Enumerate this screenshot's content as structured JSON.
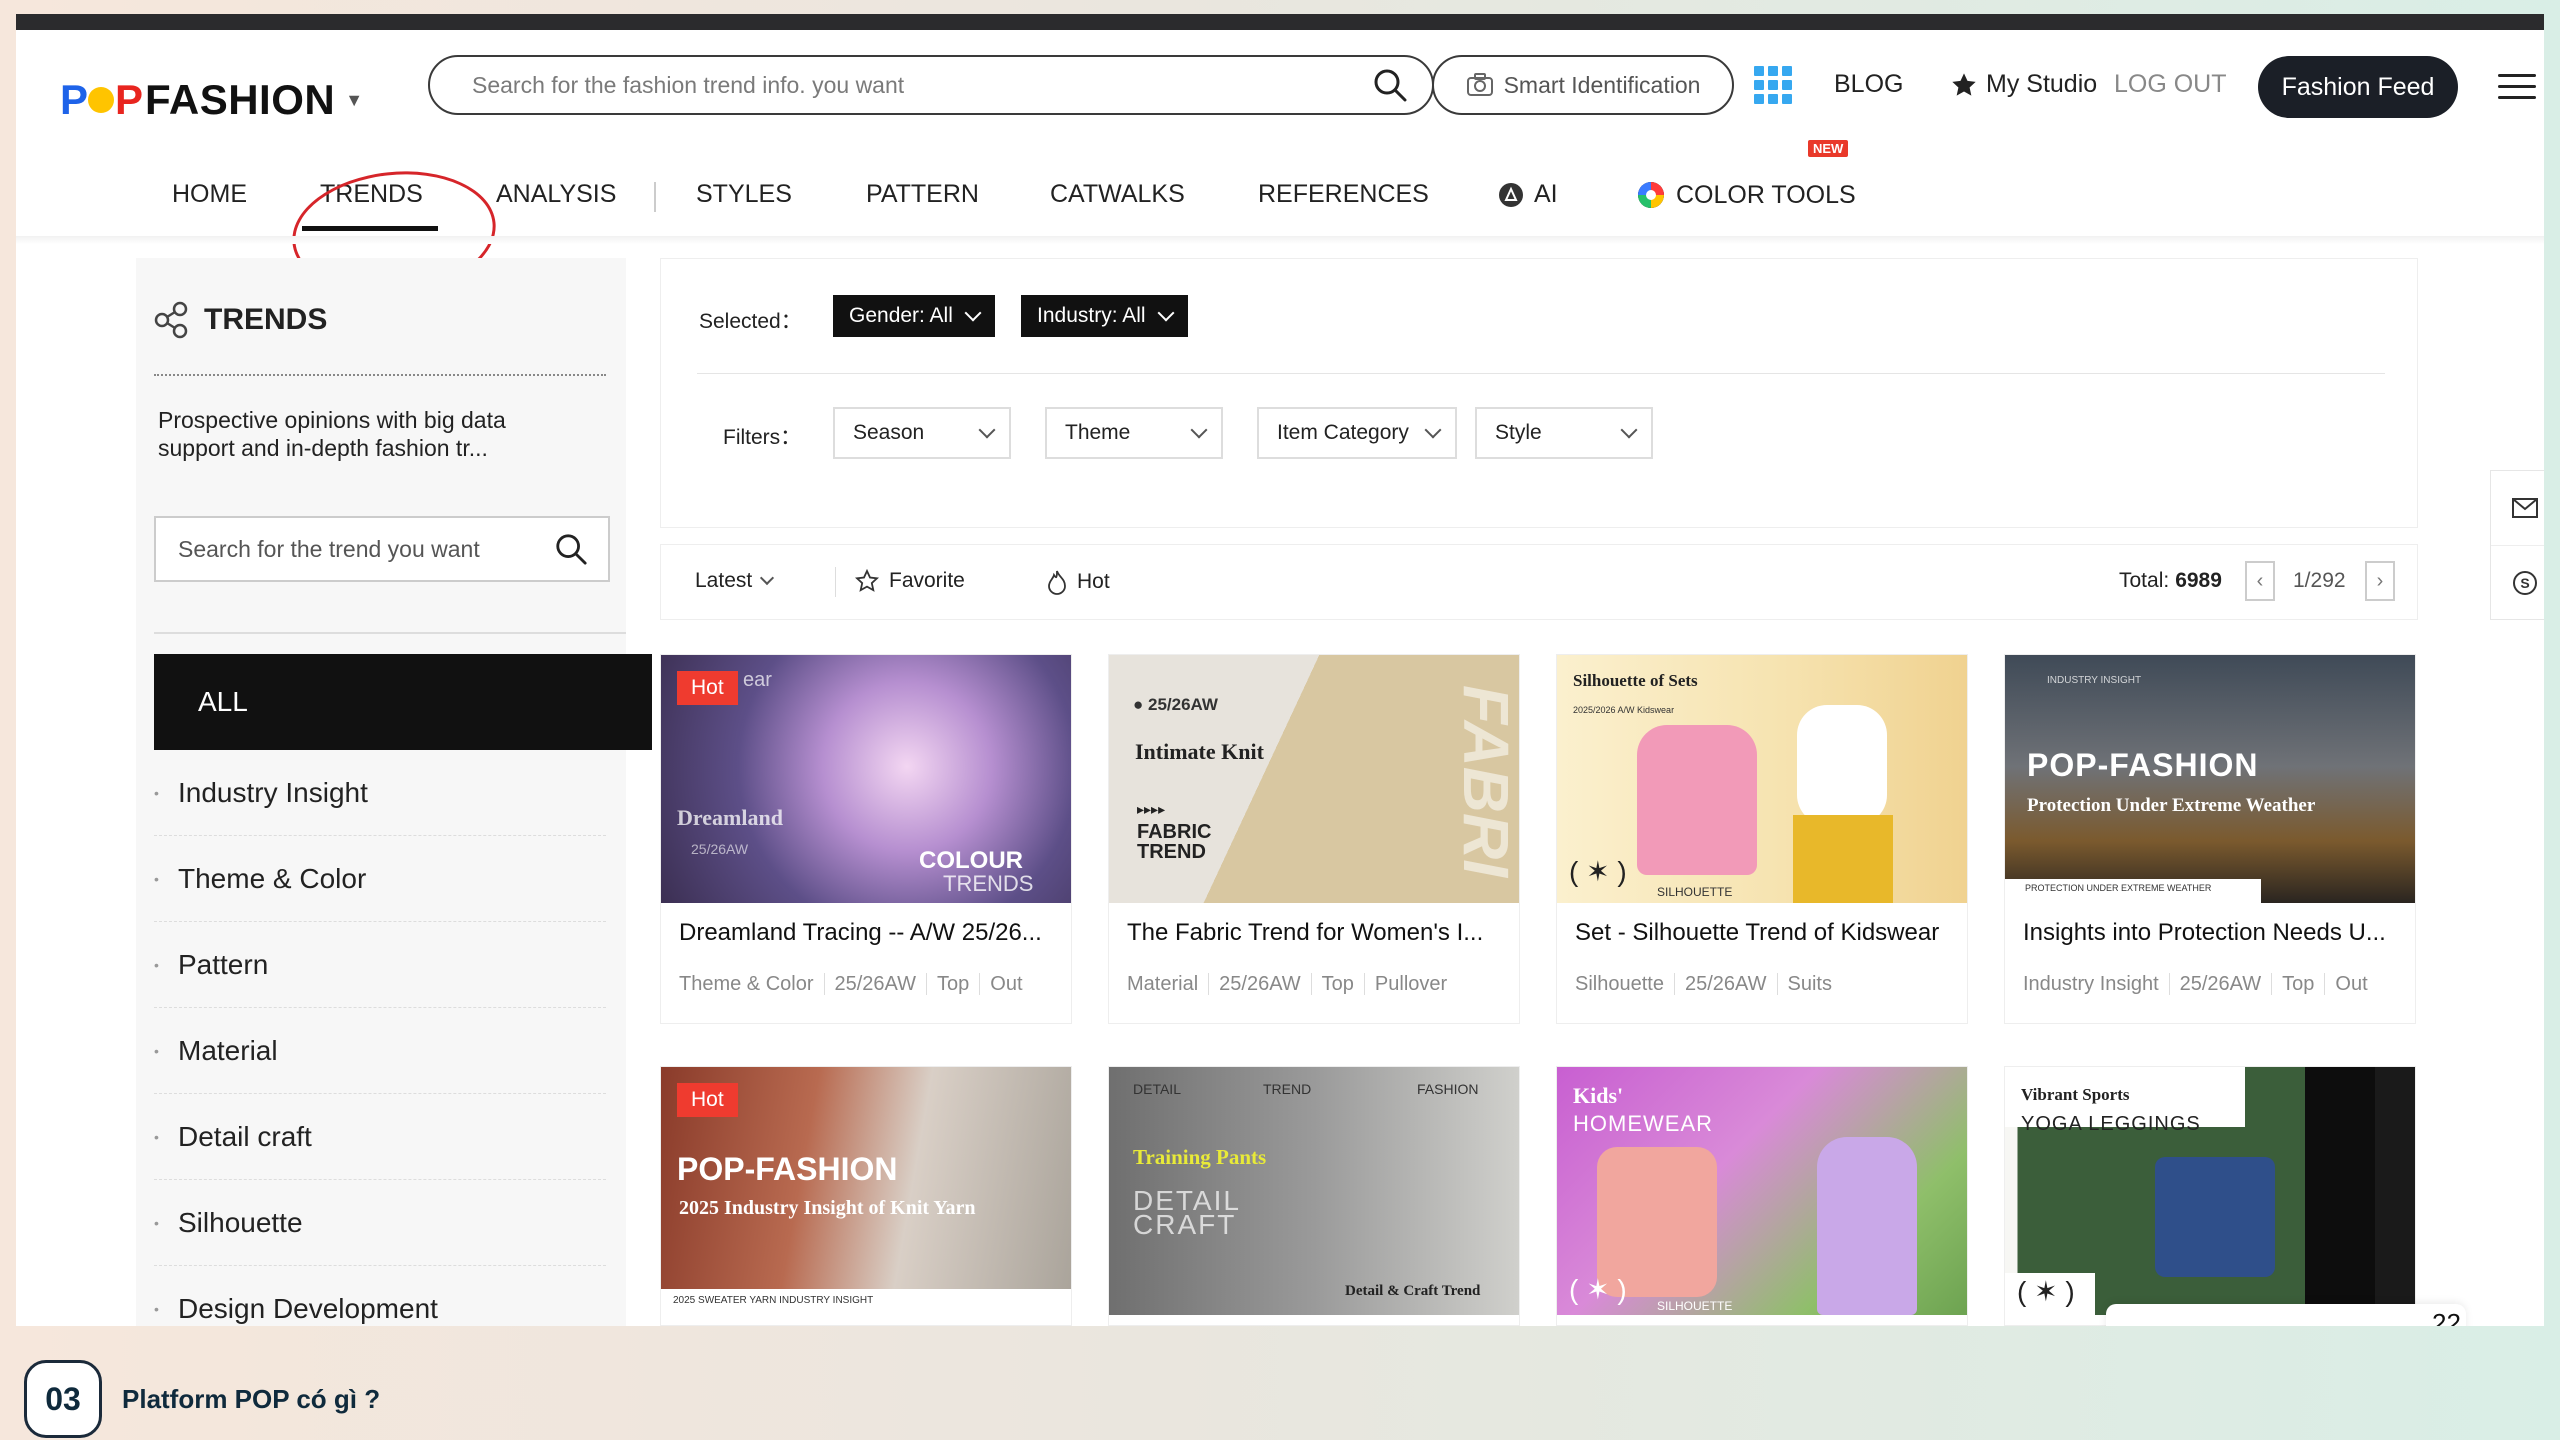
{
  "header": {
    "logo_text": "FASHION",
    "logo_prefix": "P",
    "logo_prefix2": "P",
    "search_placeholder": "Search for the fashion trend info. you want",
    "smart_identification": "Smart Identification",
    "blog": "BLOG",
    "my_studio": "My Studio",
    "log_out": "LOG OUT",
    "fashion_feed": "Fashion Feed"
  },
  "nav": {
    "items": [
      "HOME",
      "TRENDS",
      "ANALYSIS",
      "STYLES",
      "PATTERN",
      "CATWALKS",
      "REFERENCES",
      "AI",
      "COLOR TOOLS"
    ],
    "new_badge": "NEW",
    "active": "TRENDS"
  },
  "sidebar": {
    "title": "TRENDS",
    "description": "Prospective opinions with big data support and in-depth fashion tr...",
    "search_placeholder": "Search for the trend you want",
    "all_label": "ALL",
    "items": [
      "Industry Insight",
      "Theme & Color",
      "Pattern",
      "Material",
      "Detail craft",
      "Silhouette",
      "Design Development"
    ]
  },
  "filters": {
    "selected_label": "Selected：",
    "filters_label": "Filters：",
    "selected": [
      "Gender: All",
      "Industry: All"
    ],
    "dropdowns": [
      "Season",
      "Theme",
      "Item Category",
      "Style"
    ]
  },
  "sort": {
    "latest": "Latest",
    "favorite": "Favorite",
    "hot": "Hot",
    "total_label": "Total:",
    "total_value": "6989",
    "page": "1/292"
  },
  "cards": [
    {
      "title": "Dreamland Tracing -- A/W 25/26...",
      "tags": [
        "Theme & Color",
        "25/26AW",
        "Top",
        "Out"
      ],
      "hot": "Hot",
      "overlay": {
        "a": "Dreamland",
        "b": "25/26AW",
        "c": "COLOUR",
        "d": "TRENDS",
        "e": "ear"
      }
    },
    {
      "title": "The Fabric Trend for Women's I...",
      "tags": [
        "Material",
        "25/26AW",
        "Top",
        "Pullover"
      ],
      "overlay": {
        "a": "● 25/26AW",
        "b": "Intimate Knit",
        "c": "▸▸▸▸",
        "d": "FABRIC",
        "e": "TREND",
        "f": "FABRI"
      }
    },
    {
      "title": "Set - Silhouette Trend of Kidswear",
      "tags": [
        "Silhouette",
        "25/26AW",
        "Suits"
      ],
      "overlay": {
        "a": "Silhouette of Sets",
        "b": "2025/2026 A/W Kidswear",
        "c": "( ✶ )",
        "d": "SILHOUETTE"
      }
    },
    {
      "title": "Insights into Protection Needs U...",
      "tags": [
        "Industry Insight",
        "25/26AW",
        "Top",
        "Out"
      ],
      "overlay": {
        "a": "POP-FASHION",
        "b": "Protection Under Extreme Weather",
        "c": "PROTECTION UNDER EXTREME WEATHER",
        "d": "INDUSTRY INSIGHT"
      }
    }
  ],
  "cards_row2": [
    {
      "hot": "Hot",
      "overlay": {
        "a": "POP-FASHION",
        "b": "2025 Industry Insight of Knit Yarn",
        "c": "2025 SWEATER YARN INDUSTRY INSIGHT"
      }
    },
    {
      "overlay": {
        "a": "Training Pants",
        "b": "DETAIL",
        "c": "CRAFT",
        "d": "Detail & Craft Trend",
        "e": "TREND",
        "f": "FASHION"
      }
    },
    {
      "overlay": {
        "a": "Kids'",
        "b": "HOMEWEAR",
        "c": "( ✶ )",
        "d": "SILHOUETTE"
      }
    },
    {
      "overlay": {
        "a": "Vibrant Sports",
        "b": "YOGA LEGGINGS",
        "c": "( ✶ )"
      }
    }
  ],
  "message": {
    "count": "22"
  },
  "slide": {
    "number": "03",
    "title": "Platform POP có gì ?"
  }
}
